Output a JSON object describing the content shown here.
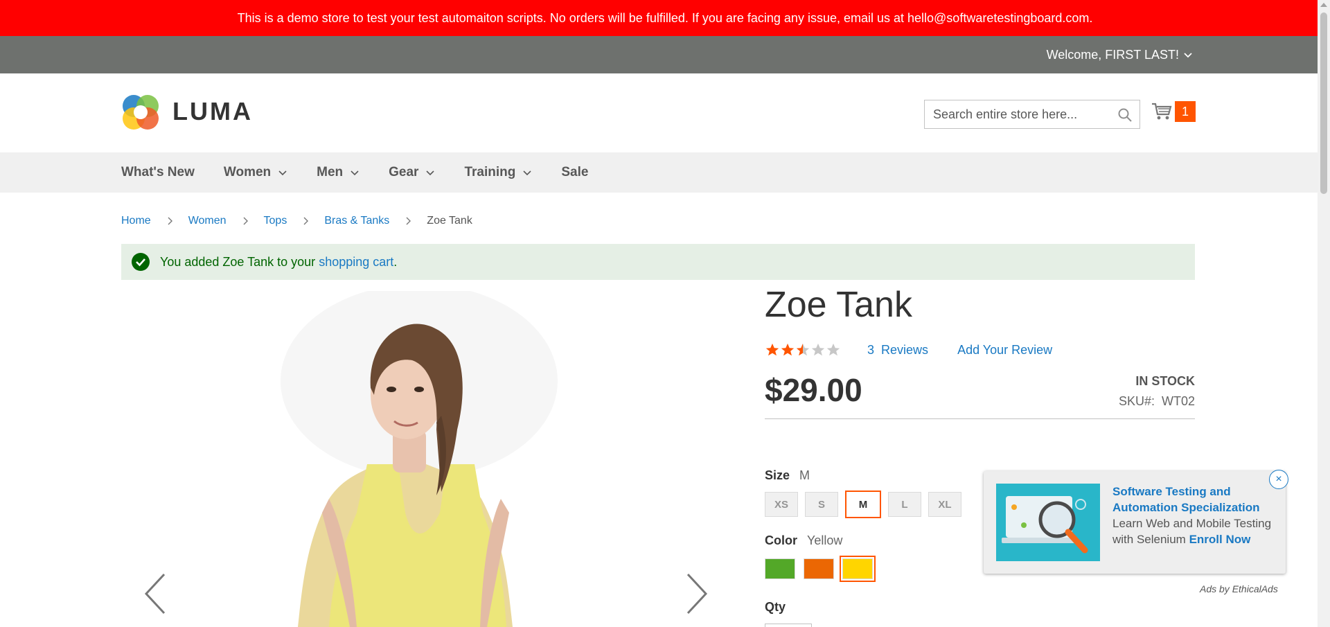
{
  "banner": {
    "text": "This is a demo store to test your test automaiton scripts. No orders will be fulfilled. If you are facing any issue, email us at hello@softwaretestingboard.com."
  },
  "topbar": {
    "welcome": "Welcome, FIRST LAST!"
  },
  "header": {
    "logo_text": "LUMA",
    "search_placeholder": "Search entire store here...",
    "cart_count": "1"
  },
  "nav": {
    "items": [
      {
        "label": "What's New",
        "dropdown": false
      },
      {
        "label": "Women",
        "dropdown": true
      },
      {
        "label": "Men",
        "dropdown": true
      },
      {
        "label": "Gear",
        "dropdown": true
      },
      {
        "label": "Training",
        "dropdown": true
      },
      {
        "label": "Sale",
        "dropdown": false
      }
    ]
  },
  "breadcrumbs": {
    "items": [
      "Home",
      "Women",
      "Tops",
      "Bras & Tanks"
    ],
    "current": "Zoe Tank"
  },
  "message": {
    "prefix": "You added Zoe Tank to your",
    "link": "shopping cart",
    "suffix": "."
  },
  "product": {
    "title": "Zoe Tank",
    "rating_stars": 2.5,
    "rating_max": 5,
    "reviews_count": "3",
    "reviews_label": "Reviews",
    "add_review": "Add Your Review",
    "price": "$29.00",
    "stock": "IN STOCK",
    "sku_label": "SKU#:",
    "sku": "WT02"
  },
  "options": {
    "size_label": "Size",
    "size_selected": "M",
    "sizes": [
      "XS",
      "S",
      "M",
      "L",
      "XL"
    ],
    "color_label": "Color",
    "color_selected": "Yellow",
    "colors": [
      {
        "name": "Green",
        "hex": "#53a828"
      },
      {
        "name": "Orange",
        "hex": "#eb6703"
      },
      {
        "name": "Yellow",
        "hex": "#ffd500"
      }
    ],
    "qty_label": "Qty"
  },
  "ad": {
    "title": "Software Testing and Automation Specialization",
    "body": "Learn Web and Mobile Testing with Selenium",
    "cta": "Enroll Now",
    "close": "×",
    "by": "Ads by EthicalAds"
  },
  "colors": {
    "brand_accent": "#ff5501",
    "link": "#1979c3",
    "banner": "#ff0000",
    "topbar": "#6e716e",
    "success_bg": "#e5efe5"
  }
}
